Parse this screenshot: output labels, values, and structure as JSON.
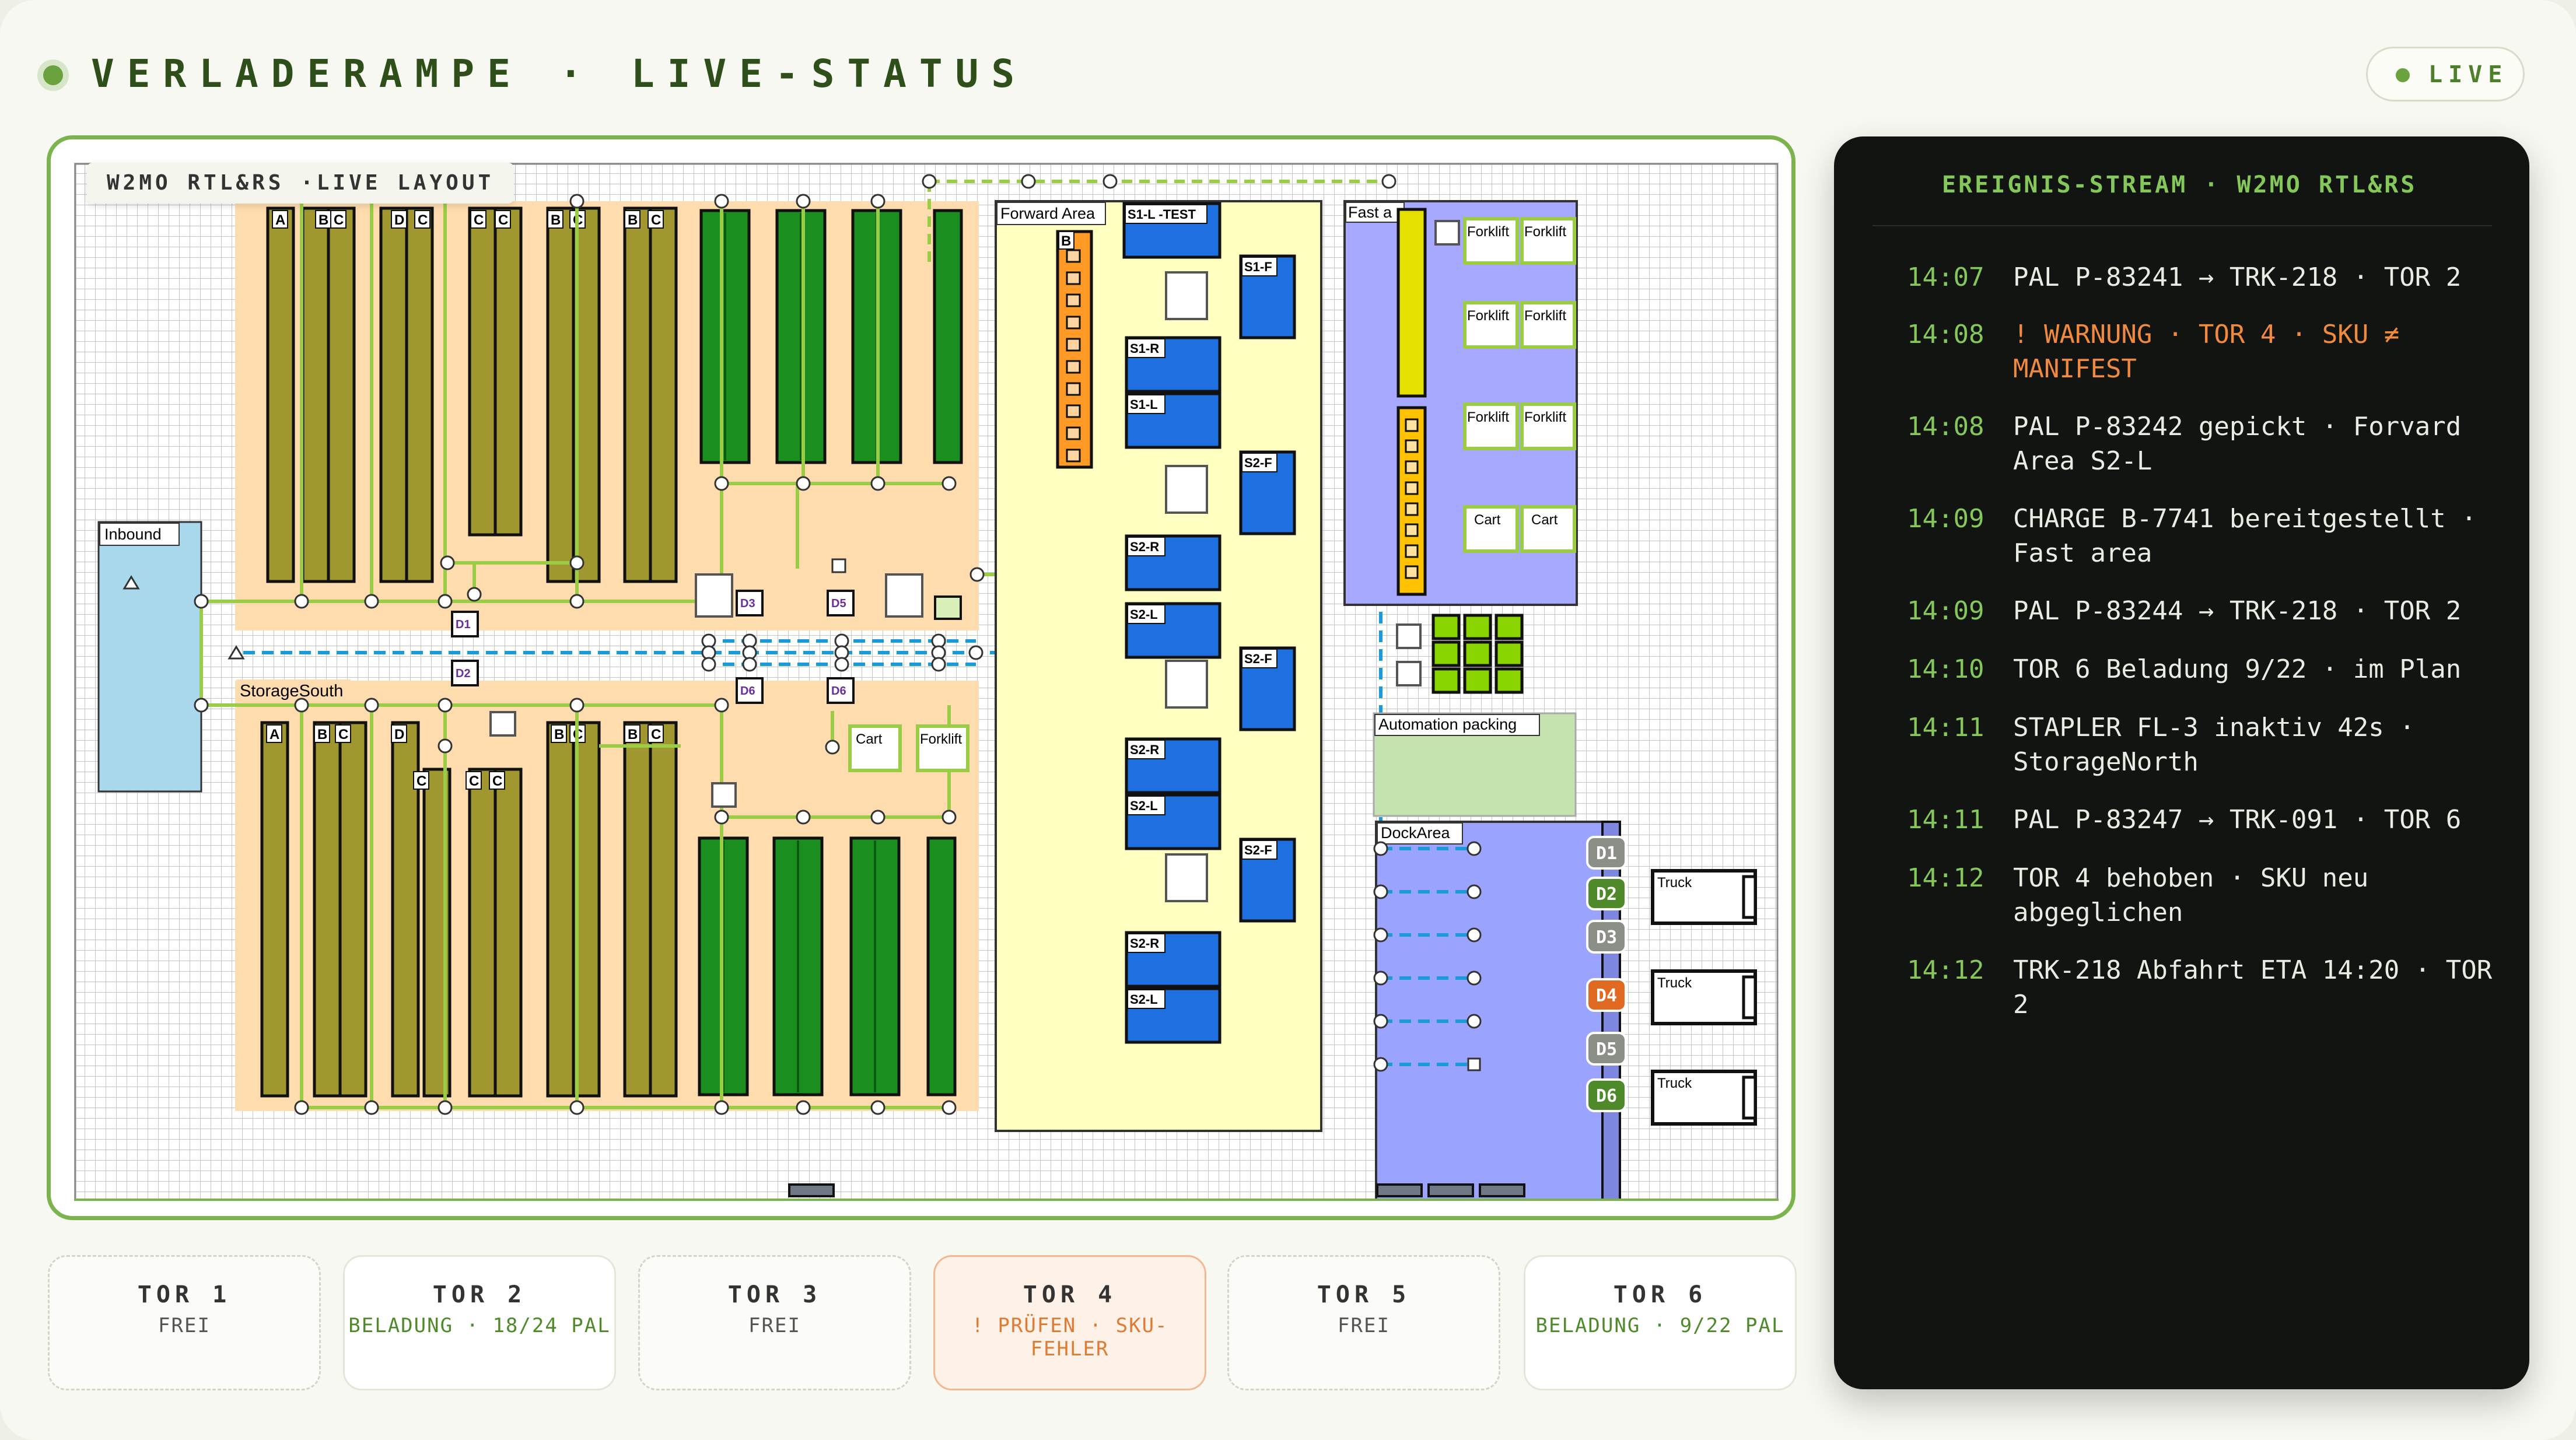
{
  "header": {
    "title": "VERLADERAMPE · LIVE-STATUS",
    "live_label": "LIVE"
  },
  "map": {
    "tag": "W2MO RTL&RS ·LIVE LAYOUT",
    "zones": {
      "inbound": "Inbound",
      "storage_south": "StorageSouth",
      "forward_area": "Forward Area",
      "fast_area": "Fast a",
      "automation_packing": "Automation packing",
      "dock_area": "DockArea"
    },
    "rack_letters": {
      "a": "A",
      "b": "B",
      "c": "C",
      "d": "D"
    },
    "shelf_labels": {
      "s1l_test": "S1-L -TEST",
      "s1f": "S1-F",
      "s1r": "S1-R",
      "s1l": "S1-L",
      "s2l": "S2-L",
      "s2r": "S2-R",
      "s2f": "S2-F",
      "b": "B"
    },
    "equipment": {
      "forklift": "Forklift",
      "cart": "Cart",
      "truck": "Truck"
    },
    "stations": {
      "d1": "D1",
      "d2": "D2",
      "d3": "D3",
      "d5": "D5",
      "d6": "D6"
    },
    "docks": [
      {
        "label": "D1",
        "state": "idle"
      },
      {
        "label": "D2",
        "state": "loading"
      },
      {
        "label": "D3",
        "state": "idle"
      },
      {
        "label": "D4",
        "state": "alert"
      },
      {
        "label": "D5",
        "state": "idle"
      },
      {
        "label": "D6",
        "state": "loading"
      }
    ]
  },
  "stream": {
    "title": "EREIGNIS-STREAM · W2MO RTL&RS",
    "events": [
      {
        "time": "14:07",
        "text": "PAL P-83241 → TRK-218 · TOR 2",
        "level": "info"
      },
      {
        "time": "14:08",
        "text": "! WARNUNG · TOR 4 · SKU ≠ MANIFEST",
        "level": "warn"
      },
      {
        "time": "14:08",
        "text": "PAL P-83242 gepickt · Forvard Area S2-L",
        "level": "info"
      },
      {
        "time": "14:09",
        "text": "CHARGE B-7741 bereitgestellt · Fast area",
        "level": "info"
      },
      {
        "time": "14:09",
        "text": "PAL P-83244 → TRK-218 · TOR 2",
        "level": "info"
      },
      {
        "time": "14:10",
        "text": "TOR 6 Beladung 9/22 · im Plan",
        "level": "info"
      },
      {
        "time": "14:11",
        "text": "STAPLER FL-3 inaktiv 42s · StorageNorth",
        "level": "info"
      },
      {
        "time": "14:11",
        "text": "PAL P-83247 → TRK-091 · TOR 6",
        "level": "info"
      },
      {
        "time": "14:12",
        "text": "TOR 4 behoben · SKU neu abgeglichen",
        "level": "info"
      },
      {
        "time": "14:12",
        "text": "TRK-218 Abfahrt ETA 14:20 · TOR 2",
        "level": "info"
      }
    ]
  },
  "gates": [
    {
      "name": "TOR 1",
      "status": "FREI",
      "state": "free"
    },
    {
      "name": "TOR 2",
      "status": "BELADUNG · 18/24 PAL",
      "state": "loading"
    },
    {
      "name": "TOR 3",
      "status": "FREI",
      "state": "free"
    },
    {
      "name": "TOR 4",
      "status": "! PRÜFEN · SKU-FEHLER",
      "state": "alert"
    },
    {
      "name": "TOR 5",
      "status": "FREI",
      "state": "free"
    },
    {
      "name": "TOR 6",
      "status": "BELADUNG · 9/22 PAL",
      "state": "loading"
    }
  ],
  "colors": {
    "accent": "#6aa23d",
    "warn": "#ef8a3e",
    "storage": "#ffdcae",
    "forward": "#ffffc2",
    "fast": "#a6a9ff",
    "dock": "#9aa4ff",
    "inbound": "#a9d8ec",
    "packing": "#c5e3af",
    "rack_olive": "#a09730",
    "rack_green": "#1a8f1f",
    "shelf_blue": "#1e6fe0",
    "path": "#1a9ad8",
    "edge": "#9acd45"
  }
}
